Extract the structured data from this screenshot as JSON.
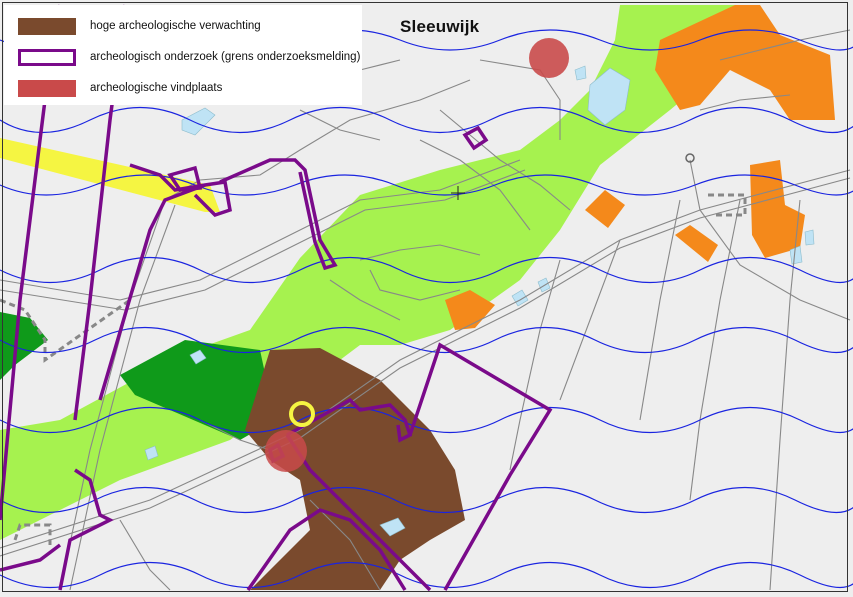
{
  "map": {
    "place_label": "Sleeuwijk",
    "colors": {
      "background": "#eeeeee",
      "green_zone": "#a6f24f",
      "dark_green": "#0f9a1a",
      "brown": "#7a4a2d",
      "orange": "#f4891b",
      "yellow": "#f5f542",
      "purple": "#7a0a8a",
      "blue_lines": "#1a24e0",
      "roads": "#888888",
      "water": "#bfe3f5",
      "red_site": "#c94a4a"
    },
    "legend": {
      "items": [
        {
          "label": "hoge archeologische verwachting",
          "swatch_color": "#7a4a2d",
          "style": "fill"
        },
        {
          "label": "archeologisch onderzoek (grens onderzoeksmelding)",
          "swatch_color": "#7a0a8a",
          "style": "outline"
        },
        {
          "label": "archeologische vindplaats",
          "swatch_color": "#c94a4a",
          "style": "fill"
        }
      ]
    },
    "markers": [
      {
        "name": "yellow-circle-marker",
        "color": "#f5f542"
      },
      {
        "name": "crosshair-marker",
        "symbol": "+"
      }
    ]
  }
}
